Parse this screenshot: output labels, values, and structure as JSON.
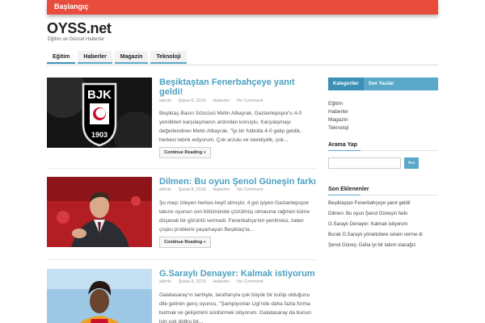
{
  "topbar": {
    "home": "Başlangıç"
  },
  "site": {
    "title": "OYSS.net",
    "description": "Eğitim ve Güncel Haberler"
  },
  "nav": [
    "Eğitim",
    "Haberler",
    "Magazin",
    "Teknoloji"
  ],
  "posts": [
    {
      "title": "Beşiktaştan Fenerbahçeye yanıt geldi!",
      "author": "admin",
      "date": "Şubat 8, 2016",
      "category": "Haberler",
      "comments": "No Comment",
      "excerpt": "Beşiktaş Basın Sözcüsü Metin Albayrak, Gaziantepspor'u 4-0 yendikleri karşılaşmanın ardından konuştu. Karşılaşmayı değerlendiren Metin Albayrak, \"İyi bir futbolla 4-0 galip geldik, herkesi tebrik ediyorum. Çok arzulu ve istekliydik, çok...",
      "more": "Continue Reading »",
      "thumb_text": "BJK 1903"
    },
    {
      "title": "Dilmen: Bu oyun Şenol Güneşin farkı",
      "author": "admin",
      "date": "Şubat 8, 2016",
      "category": "Haberler",
      "comments": "No Comment",
      "excerpt": "Şu maçı izleyen herkes keyif almıştır, 4 gol iyiyen Gaziantepspor takımı oyunun son bölümünde çözülmüş olmasına rağmen küme düşecek bir görüntü vermedi. Fenerbahçe'nin yenilmesi, zaten çoşku problemi yaşamayan Beşiktaş'ta...",
      "more": "Continue Reading »"
    },
    {
      "title": "G.Saraylı Denayer: Kalmak istiyorum",
      "author": "admin",
      "date": "Şubat 8, 2016",
      "category": "Haberler",
      "comments": "No Comment",
      "excerpt": "Galatasaray'ın tarihiyle, taraftarıyla çok büyük bir kulüp olduğunu dile getiren genç oyuncu, \"Şampiyonlar Ligi'nde daha fazla forma bulmak ve gelişimimi sürdürmek istiyorum. Galatasaray da bunun için çok doğru bir..."
    }
  ],
  "sidebar": {
    "tabs": [
      "Kategoriler",
      "Son Yazılar"
    ],
    "categories": [
      "Eğitim",
      "Haberler",
      "Magazin",
      "Teknoloji"
    ],
    "search_title": "Arama Yap",
    "search_button": "Ara",
    "recent_title": "Son Eklenenler",
    "recent": [
      "Beşiktaştan Fenerbahçeye yanıt geldi!",
      "Dilmen: Bu oyun Şenol Güneşin farkı",
      "G.Saraylı Denayer: Kalmak istiyorum",
      "Burak G.Saraylı yöneticilere selam verme di",
      "Şenol Güneş: Daha iyi bir takım olacağız"
    ]
  }
}
